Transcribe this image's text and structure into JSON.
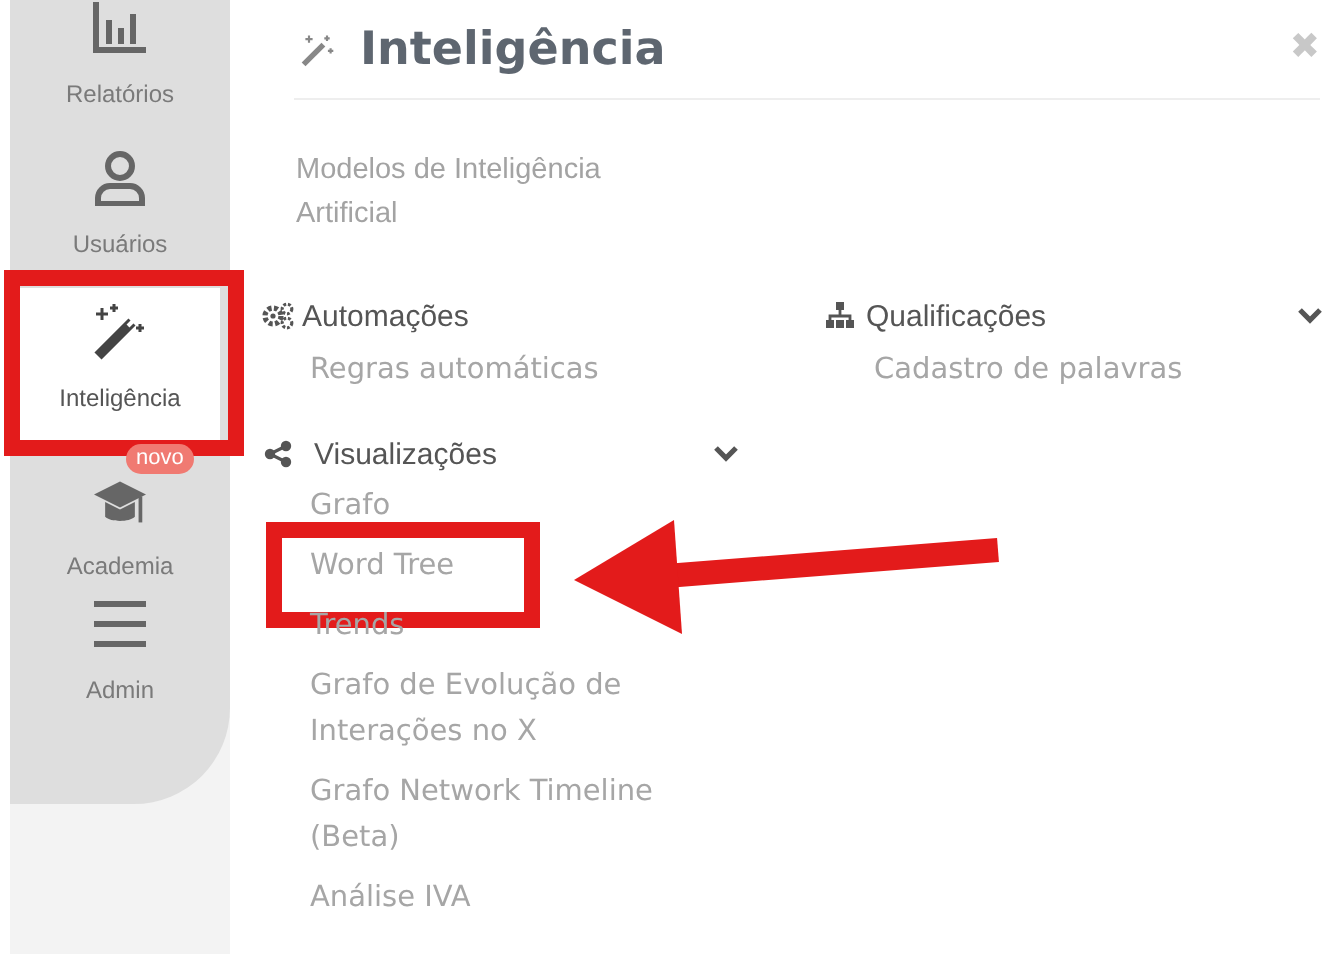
{
  "sidebar": {
    "items": [
      {
        "label": "Relatórios",
        "selected": false,
        "highlighted": false
      },
      {
        "label": "Usuários",
        "selected": false,
        "highlighted": false
      },
      {
        "label": "Inteligência",
        "selected": true,
        "highlighted": true
      },
      {
        "label": "Academia",
        "badge": "novo",
        "selected": false,
        "highlighted": false
      },
      {
        "label": "Admin",
        "selected": false,
        "highlighted": false
      }
    ]
  },
  "panel": {
    "title": "Inteligência",
    "close": "✖",
    "intro": "Modelos de Inteligência Artificial",
    "groups": [
      {
        "title": "Automações",
        "toggle": false,
        "items": [
          {
            "label": "Regras automáticas",
            "highlighted": false
          }
        ]
      },
      {
        "title": "Qualificações",
        "toggle": true,
        "items": [
          {
            "label": "Cadastro de palavras",
            "highlighted": false
          }
        ]
      },
      {
        "title": "Visualizações",
        "toggle": true,
        "items": [
          {
            "label": "Grafo",
            "highlighted": false
          },
          {
            "label": "Word Tree",
            "highlighted": true
          },
          {
            "label": "Trends",
            "highlighted": false
          },
          {
            "label": "Grafo de Evolução de Interações no X",
            "highlighted": false
          },
          {
            "label": "Grafo Network Timeline (Beta)",
            "highlighted": false
          },
          {
            "label": "Análise IVA",
            "highlighted": false
          }
        ]
      }
    ]
  }
}
